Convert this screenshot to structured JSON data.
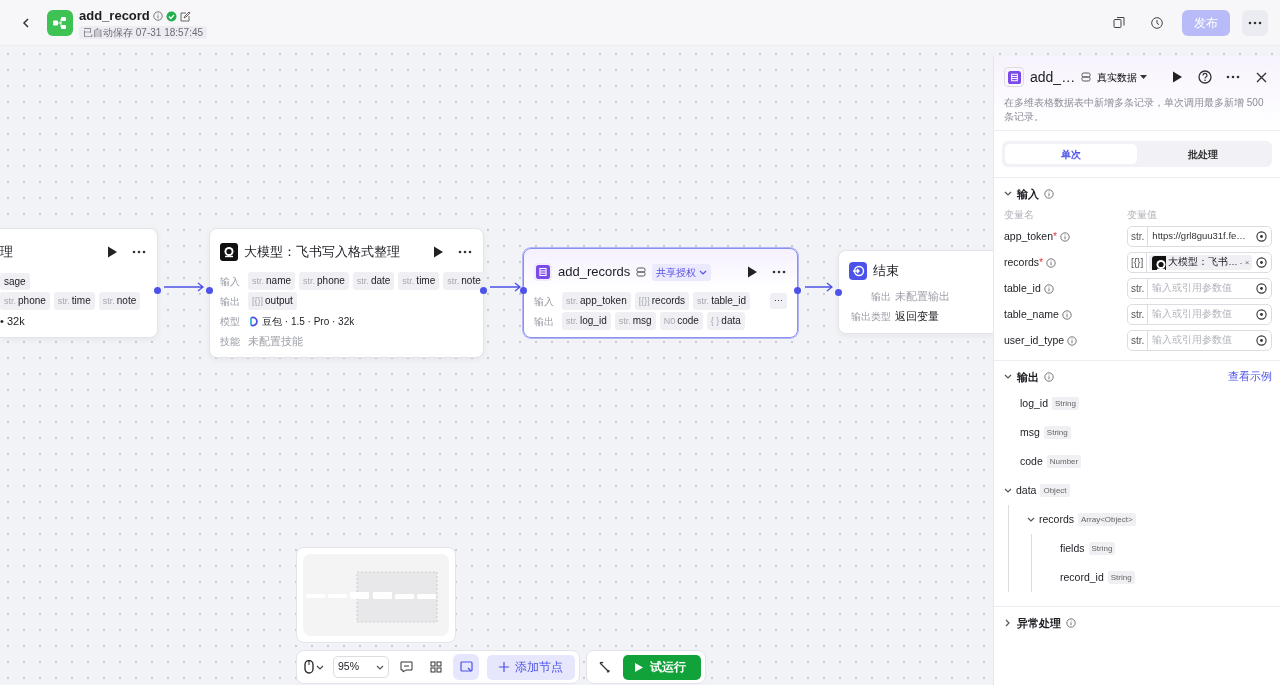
{
  "header": {
    "title": "add_record",
    "saved": "已自动保存 07-31 18:57:45",
    "publish": {
      "label": "发布",
      "disabled": true
    }
  },
  "nodes": [
    {
      "kind": "partial",
      "title": "理",
      "selected": false,
      "rows": [
        {
          "kind": "chips",
          "chips": [
            {
              "name": "sage"
            }
          ]
        },
        {
          "kind": "chips",
          "chips": [
            {
              "type": "str.",
              "name": "phone"
            },
            {
              "type": "str.",
              "name": "time"
            },
            {
              "type": "str.",
              "name": "note"
            }
          ]
        },
        {
          "kind": "text",
          "text": "• 32k",
          "muted": false
        }
      ]
    },
    {
      "kind": "llm",
      "title": "大模型：飞书写入格式整理",
      "selected": false,
      "rows": [
        {
          "kind": "chips",
          "label": "输入",
          "chips": [
            {
              "type": "str.",
              "name": "name"
            },
            {
              "type": "str.",
              "name": "phone"
            },
            {
              "type": "str.",
              "name": "date"
            },
            {
              "type": "str.",
              "name": "time"
            },
            {
              "type": "str.",
              "name": "note"
            }
          ]
        },
        {
          "kind": "chips",
          "label": "输出",
          "chips": [
            {
              "type": "[{}]",
              "name": "output"
            }
          ]
        },
        {
          "kind": "model",
          "label": "模型",
          "text": "豆包 · 1.5 · Pro · 32k"
        },
        {
          "kind": "text",
          "label": "技能",
          "text": "未配置技能",
          "muted": true
        }
      ]
    },
    {
      "kind": "plugin",
      "title": "add_records",
      "auth": "共享授权",
      "selected": true,
      "rows": [
        {
          "kind": "chips",
          "label": "输入",
          "more": "···",
          "chips": [
            {
              "type": "str.",
              "name": "app_token"
            },
            {
              "type": "[{}]",
              "name": "records"
            },
            {
              "type": "str.",
              "name": "table_id"
            }
          ]
        },
        {
          "kind": "chips",
          "label": "输出",
          "chips": [
            {
              "type": "str.",
              "name": "log_id"
            },
            {
              "type": "str.",
              "name": "msg"
            },
            {
              "type": "N0",
              "name": "code"
            },
            {
              "type": "{ }",
              "name": "data"
            }
          ]
        }
      ]
    },
    {
      "kind": "end",
      "title": "结束",
      "selected": false,
      "rows": [
        {
          "kind": "text",
          "label": "输出",
          "text": "未配置输出",
          "muted": true
        },
        {
          "kind": "text",
          "label": "输出类型",
          "text": "返回变量",
          "muted": false
        }
      ]
    }
  ],
  "toolbar": {
    "zoom": "95%",
    "add_node": "添加节点",
    "test_run": "试运行"
  },
  "panel": {
    "title": "add_…",
    "data_mode": "真实数据",
    "description": "在多维表格数据表中新增多条记录，单次调用最多新增 500 条记录。",
    "tabs": [
      {
        "label": "单次",
        "selected": true
      },
      {
        "label": "批处理",
        "selected": false
      }
    ],
    "input": {
      "title": "输入",
      "expanded": true,
      "required_mark": "*",
      "name_header": "变量名",
      "value_header": "变量值",
      "params": [
        {
          "name": "app_token",
          "required": true,
          "type": "str.",
          "kind": "value",
          "value": "https://grl8guu31f.fe…"
        },
        {
          "name": "records",
          "required": true,
          "type": "[{}]",
          "kind": "ref",
          "value": "大模型：飞书…",
          "suffix": "- ×"
        },
        {
          "name": "table_id",
          "required": false,
          "type": "str.",
          "kind": "empty",
          "placeholder": "输入或引用参数值"
        },
        {
          "name": "table_name",
          "required": false,
          "type": "str.",
          "kind": "empty",
          "placeholder": "输入或引用参数值"
        },
        {
          "name": "user_id_type",
          "required": false,
          "type": "str.",
          "kind": "empty",
          "placeholder": "输入或引用参数值"
        }
      ]
    },
    "output": {
      "title": "输出",
      "expanded": true,
      "link": "查看示例",
      "fields": [
        {
          "name": "log_id",
          "type": "String"
        },
        {
          "name": "msg",
          "type": "String"
        },
        {
          "name": "code",
          "type": "Number"
        },
        {
          "name": "data",
          "type": "Object",
          "expanded": true,
          "children": [
            {
              "name": "records",
              "type": "Array<Object>",
              "expanded": true,
              "children": [
                {
                  "name": "fields",
                  "type": "String"
                },
                {
                  "name": "record_id",
                  "type": "String"
                }
              ]
            }
          ]
        }
      ]
    },
    "error": {
      "title": "异常处理",
      "expanded": false
    }
  }
}
